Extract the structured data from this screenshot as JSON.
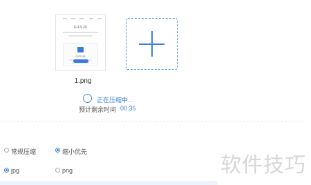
{
  "upload": {
    "file": {
      "name": "1.png",
      "thumbnail_brand_text": "GIFSJR",
      "thumbnail_card_text": "GIFSJR"
    },
    "add_button_icon": "plus-icon",
    "status_icon": "spinner-icon",
    "status_text": "正在压缩中...",
    "remaining_label": "预计剩余时间",
    "remaining_value": "00:35"
  },
  "options": {
    "compress_mode": [
      {
        "label": "常规压缩",
        "selected": false
      },
      {
        "label": "缩小优先",
        "selected": true
      }
    ],
    "format": [
      {
        "label": "jpg",
        "selected": true
      },
      {
        "label": "png",
        "selected": false
      }
    ]
  },
  "watermark": "软件技巧",
  "colors": {
    "accent": "#3b82d9",
    "dashed_border": "#4a8fe0",
    "watermark": "#d7d7d7"
  }
}
